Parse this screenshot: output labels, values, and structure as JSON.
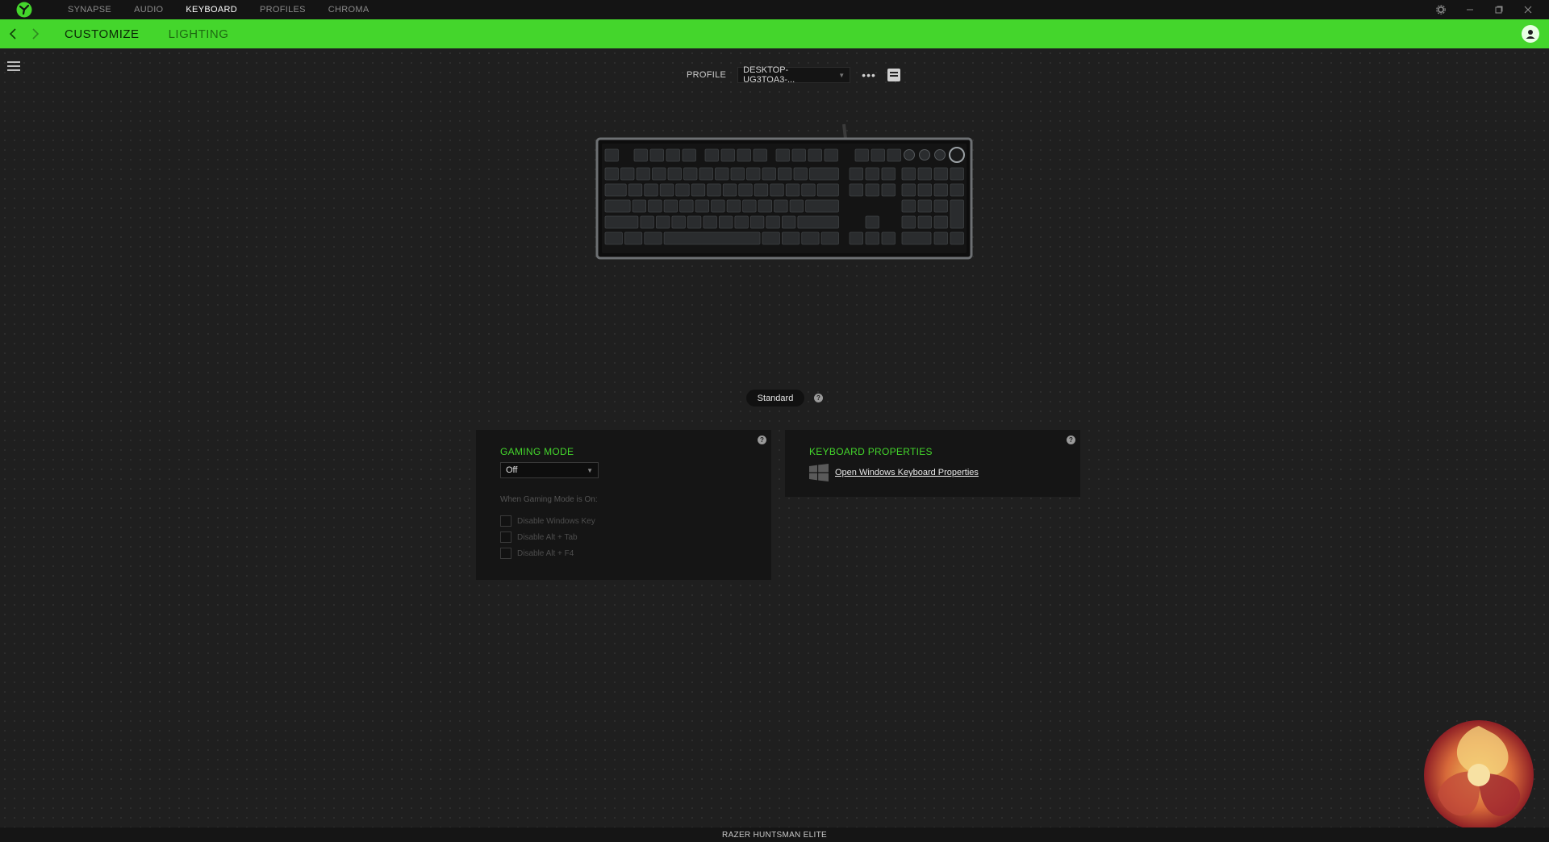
{
  "topnav": {
    "tabs": [
      {
        "label": "SYNAPSE",
        "active": false
      },
      {
        "label": "AUDIO",
        "active": false
      },
      {
        "label": "KEYBOARD",
        "active": true
      },
      {
        "label": "PROFILES",
        "active": false
      },
      {
        "label": "CHROMA",
        "active": false
      }
    ]
  },
  "subnav": {
    "tabs": [
      {
        "label": "CUSTOMIZE",
        "active": true
      },
      {
        "label": "LIGHTING",
        "active": false
      }
    ]
  },
  "profile": {
    "label": "PROFILE",
    "value": "DESKTOP-UG3TOA3-..."
  },
  "mode": {
    "label": "Standard"
  },
  "gaming_mode": {
    "title": "GAMING MODE",
    "selected": "Off",
    "note": "When Gaming Mode is On:",
    "options": [
      "Disable Windows Key",
      "Disable Alt + Tab",
      "Disable Alt + F4"
    ]
  },
  "keyboard_properties": {
    "title": "KEYBOARD PROPERTIES",
    "link": "Open Windows Keyboard Properties"
  },
  "status": {
    "device": "RAZER HUNTSMAN ELITE"
  },
  "colors": {
    "accent": "#44d62c",
    "background": "#1f1f1f",
    "panel": "#151515"
  },
  "icons": {
    "app_logo": "razer-logo-icon",
    "settings": "gear-icon",
    "minimize": "minimize-icon",
    "maximize": "maximize-icon",
    "close": "close-icon",
    "back": "chevron-left-icon",
    "forward": "chevron-right-icon",
    "account": "user-icon",
    "menu": "hamburger-icon",
    "more": "ellipsis-icon",
    "device": "device-icon",
    "help": "help-icon",
    "windows": "windows-logo-icon"
  }
}
